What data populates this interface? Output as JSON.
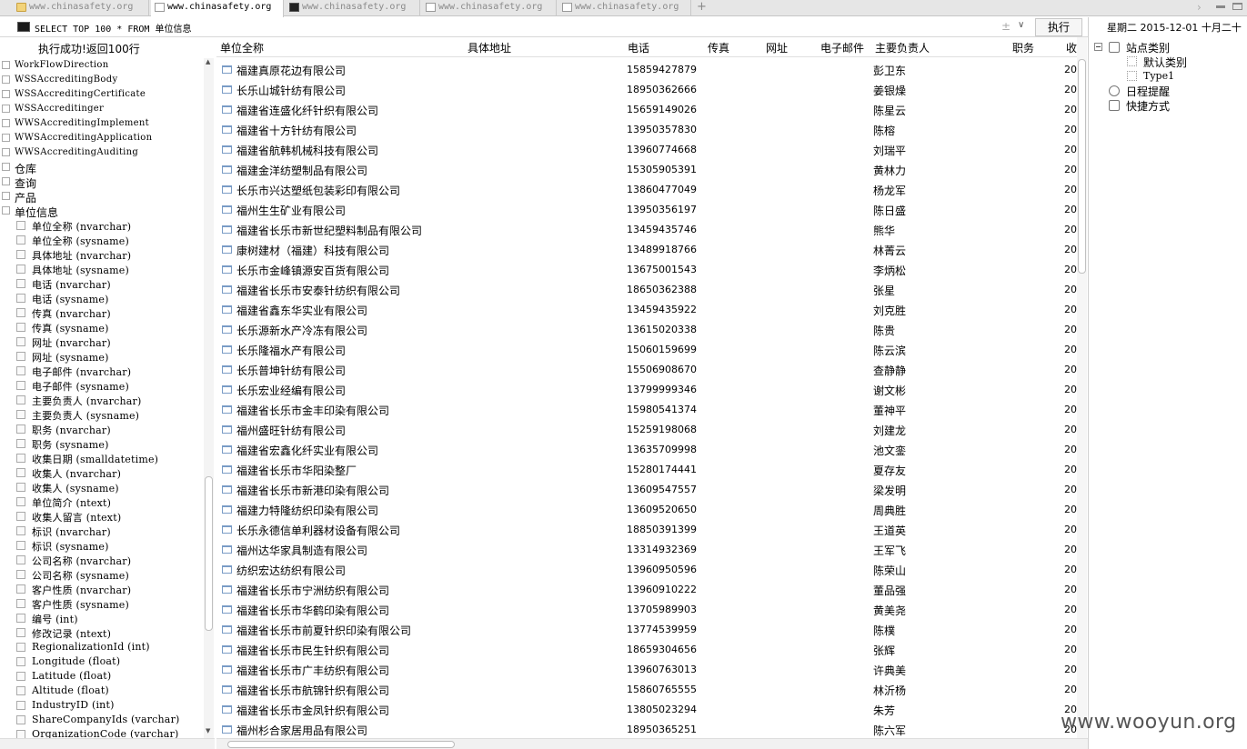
{
  "tabs": [
    {
      "label": "www.chinasafety.org",
      "icon": "folder-icon",
      "active": false
    },
    {
      "label": "www.chinasafety.org",
      "icon": "page-icon",
      "active": true
    },
    {
      "label": "www.chinasafety.org",
      "icon": "terminal-icon",
      "active": false
    },
    {
      "label": "www.chinasafety.org",
      "icon": "page-icon",
      "active": false
    },
    {
      "label": "www.chinasafety.org",
      "icon": "page-icon",
      "active": false
    }
  ],
  "tabbar": {
    "add": "+",
    "arrow": "›"
  },
  "query": {
    "value": "SELECT TOP 100 * FROM 单位信息",
    "pm": "±",
    "drop": "∨",
    "exec_label": "执行"
  },
  "status": "执行成功!返回100行",
  "columns": [
    "单位全称",
    "具体地址",
    "电话",
    "传真",
    "网址",
    "电子邮件",
    "主要负责人",
    "职务",
    "收"
  ],
  "left_tree": {
    "tables": [
      "WorkFlowDirection",
      "WSSAccreditingBody",
      "WSSAccreditingCertificate",
      "WSSAccreditinger",
      "WWSAccreditingImplement",
      "WWSAccreditingApplication",
      "WWSAccreditingAuditing"
    ],
    "groups": [
      "仓库",
      "查询",
      "产品",
      "单位信息"
    ],
    "fields": [
      "单位全称 (nvarchar)",
      "单位全称 (sysname)",
      "具体地址 (nvarchar)",
      "具体地址 (sysname)",
      "电话 (nvarchar)",
      "电话 (sysname)",
      "传真 (nvarchar)",
      "传真 (sysname)",
      "网址 (nvarchar)",
      "网址 (sysname)",
      "电子邮件 (nvarchar)",
      "电子邮件 (sysname)",
      "主要负责人 (nvarchar)",
      "主要负责人 (sysname)",
      "职务 (nvarchar)",
      "职务 (sysname)",
      "收集日期 (smalldatetime)",
      "收集人 (nvarchar)",
      "收集人 (sysname)",
      "单位简介 (ntext)",
      "收集人留言 (ntext)",
      "标识 (nvarchar)",
      "标识 (sysname)",
      "公司名称 (nvarchar)",
      "公司名称 (sysname)",
      "客户性质 (nvarchar)",
      "客户性质 (sysname)",
      "编号 (int)",
      "修改记录 (ntext)",
      "RegionalizationId (int)",
      "Longitude (float)",
      "Latitude (float)",
      "Altitude (float)",
      "IndustryID (int)",
      "ShareCompanyIds (varchar)",
      "OrganizationCode (varchar)"
    ]
  },
  "rows": [
    {
      "name": "福建真原花边有限公司",
      "phone": "15859427879",
      "person": "彭卫东",
      "date": "20"
    },
    {
      "name": "长乐山城针纺有限公司",
      "phone": "18950362666",
      "person": "姜银燥",
      "date": "20"
    },
    {
      "name": "福建省连盛化纤针织有限公司",
      "phone": "15659149026",
      "person": "陈星云",
      "date": "20"
    },
    {
      "name": "福建省十方针纺有限公司",
      "phone": "13950357830",
      "person": "陈榕",
      "date": "20"
    },
    {
      "name": "福建省航韩机械科技有限公司",
      "phone": "13960774668",
      "person": "刘瑞平",
      "date": "20"
    },
    {
      "name": "福建金洋纺塑制品有限公司",
      "phone": "15305905391",
      "person": "黄林力",
      "date": "20"
    },
    {
      "name": "长乐市兴达塑纸包装彩印有限公司",
      "phone": "13860477049",
      "person": "杨龙军",
      "date": "20"
    },
    {
      "name": "福州生生矿业有限公司",
      "phone": "13950356197",
      "person": "陈日盛",
      "date": "20"
    },
    {
      "name": "福建省长乐市新世纪塑料制品有限公司",
      "phone": "13459435746",
      "person": "熊华",
      "date": "20"
    },
    {
      "name": "康树建材（福建）科技有限公司",
      "phone": "13489918766",
      "person": "林菁云",
      "date": "20"
    },
    {
      "name": "长乐市金峰镇源安百货有限公司",
      "phone": "13675001543",
      "person": "李炳松",
      "date": "20"
    },
    {
      "name": "福建省长乐市安泰针纺织有限公司",
      "phone": "18650362388",
      "person": "张星",
      "date": "20"
    },
    {
      "name": "福建省鑫东华实业有限公司",
      "phone": "13459435922",
      "person": "刘克胜",
      "date": "20"
    },
    {
      "name": "长乐源新水产冷冻有限公司",
      "phone": "13615020338",
      "person": "陈贵",
      "date": "20"
    },
    {
      "name": "长乐隆福水产有限公司",
      "phone": "15060159699",
      "person": "陈云滨",
      "date": "20"
    },
    {
      "name": "长乐普坤针纺有限公司",
      "phone": "15506908670",
      "person": "查静静",
      "date": "20"
    },
    {
      "name": "长乐宏业经编有限公司",
      "phone": "13799999346",
      "person": "谢文彬",
      "date": "20"
    },
    {
      "name": "福建省长乐市金丰印染有限公司",
      "phone": "15980541374",
      "person": "董神平",
      "date": "20"
    },
    {
      "name": "福州盛旺针纺有限公司",
      "phone": "15259198068",
      "person": "刘建龙",
      "date": "20"
    },
    {
      "name": "福建省宏鑫化纤实业有限公司",
      "phone": "13635709998",
      "person": "池文銮",
      "date": "20"
    },
    {
      "name": "福建省长乐市华阳染整厂",
      "phone": "15280174441",
      "person": "夏存友",
      "date": "20"
    },
    {
      "name": "福建省长乐市新港印染有限公司",
      "phone": "13609547557",
      "person": "梁发明",
      "date": "20"
    },
    {
      "name": "福建力特隆纺织印染有限公司",
      "phone": "13609520650",
      "person": "周典胜",
      "date": "20"
    },
    {
      "name": "长乐永德信单利器材设备有限公司",
      "phone": "18850391399",
      "person": "王道英",
      "date": "20"
    },
    {
      "name": "福州达华家具制造有限公司",
      "phone": "13314932369",
      "person": "王军飞",
      "date": "20"
    },
    {
      "name": "纺织宏达纺织有限公司",
      "phone": "13960950596",
      "person": "陈荣山",
      "date": "20"
    },
    {
      "name": "福建省长乐市宁洲纺织有限公司",
      "phone": "13960910222",
      "person": "董品强",
      "date": "20"
    },
    {
      "name": "福建省长乐市华鹤印染有限公司",
      "phone": "13705989903",
      "person": "黄美尧",
      "date": "20"
    },
    {
      "name": "福建省长乐市前夏针织印染有限公司",
      "phone": "13774539959",
      "person": "陈樸",
      "date": "20"
    },
    {
      "name": "福建省长乐市民生针织有限公司",
      "phone": "18659304656",
      "person": "张辉",
      "date": "20"
    },
    {
      "name": "福建省长乐市广丰纺织有限公司",
      "phone": "13960763013",
      "person": "许典美",
      "date": "20"
    },
    {
      "name": "福建省长乐市航锦针织有限公司",
      "phone": "15860765555",
      "person": "林沂杨",
      "date": "20"
    },
    {
      "name": "福建省长乐市金凤针织有限公司",
      "phone": "13805023294",
      "person": "朱芳",
      "date": "20"
    },
    {
      "name": "福州杉合家居用品有限公司",
      "phone": "18950365251",
      "person": "陈六军",
      "date": "20"
    }
  ],
  "right_panel": {
    "date": "星期二  2015-12-01  十月二十",
    "site_category": "站点类别",
    "default_category": "默认类别",
    "type1": "Type1",
    "schedule": "日程提醒",
    "shortcut": "快捷方式"
  },
  "watermark": "www.wooyun.org"
}
